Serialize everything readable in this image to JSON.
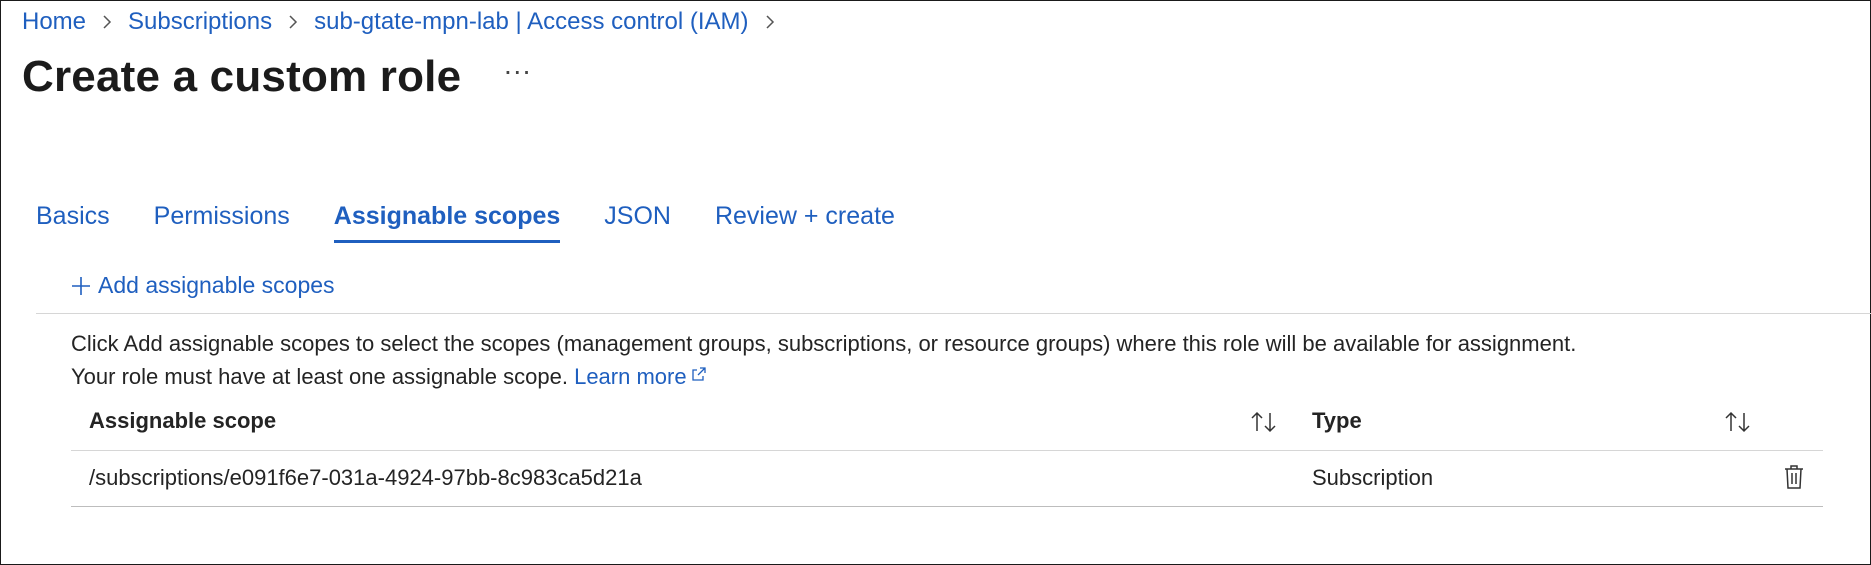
{
  "breadcrumb": [
    {
      "label": "Home"
    },
    {
      "label": "Subscriptions"
    },
    {
      "label": "sub-gtate-mpn-lab | Access control (IAM)"
    }
  ],
  "page": {
    "title": "Create a custom role",
    "more_label": "···"
  },
  "tabs": [
    {
      "label": "Basics",
      "active": false
    },
    {
      "label": "Permissions",
      "active": false
    },
    {
      "label": "Assignable scopes",
      "active": true
    },
    {
      "label": "JSON",
      "active": false
    },
    {
      "label": "Review + create",
      "active": false
    }
  ],
  "toolbar": {
    "add_scopes_label": "Add assignable scopes",
    "add_icon": "plus-icon"
  },
  "description": {
    "line1": "Click Add assignable scopes to select the scopes (management groups, subscriptions, or resource groups) where this role will be available for assignment.",
    "line2": "Your role must have at least one assignable scope.",
    "learn_more": "Learn more",
    "learn_more_icon": "external-link-icon"
  },
  "table": {
    "columns": [
      "Assignable scope",
      "Type"
    ],
    "rows": [
      {
        "scope": "/subscriptions/e091f6e7-031a-4924-97bb-8c983ca5d21a",
        "type": "Subscription"
      }
    ]
  },
  "colors": {
    "link": "#1f5fbf",
    "text": "#242424",
    "divider": "#d6d6d6"
  }
}
